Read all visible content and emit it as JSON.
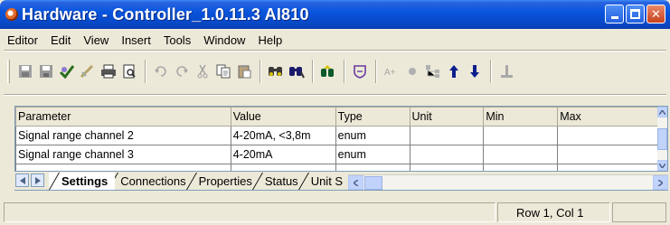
{
  "window": {
    "title": "Hardware - Controller_1.0.11.3  AI810",
    "icon": "app-icon",
    "controls": [
      "minimize",
      "maximize",
      "close"
    ]
  },
  "menu": [
    "Editor",
    "Edit",
    "View",
    "Insert",
    "Tools",
    "Window",
    "Help"
  ],
  "toolbar": {
    "groups": [
      [
        "save-all-icon",
        "save-icon",
        "check-icon",
        "edit-check-icon",
        "print-icon",
        "print-preview-icon"
      ],
      [
        "undo-icon",
        "redo-icon",
        "cut-icon",
        "copy-icon",
        "paste-icon"
      ],
      [
        "find-icon",
        "find-replace-icon"
      ],
      [
        "navigate-icon"
      ],
      [
        "shield-icon"
      ],
      [
        "font-size-icon",
        "circle-icon",
        "hierarchy-icon",
        "arrow-up-icon",
        "arrow-down-icon"
      ],
      [
        "anchor-icon"
      ]
    ]
  },
  "grid": {
    "columns": [
      "Parameter",
      "Value",
      "Type",
      "Unit",
      "Min",
      "Max"
    ],
    "rows": [
      [
        "Signal range channel 2",
        "4-20mA, <3,8m",
        "enum",
        "",
        "",
        ""
      ],
      [
        "Signal range channel 3",
        "4-20mA",
        "enum",
        "",
        "",
        ""
      ]
    ]
  },
  "tabs": [
    "Settings",
    "Connections",
    "Properties",
    "Status",
    "Unit S"
  ],
  "active_tab": "Settings",
  "status": {
    "position": "Row 1, Col 1"
  },
  "colors": {
    "titlebar": "#0855dd",
    "chrome": "#ece9d8",
    "grid_border": "#808080"
  }
}
